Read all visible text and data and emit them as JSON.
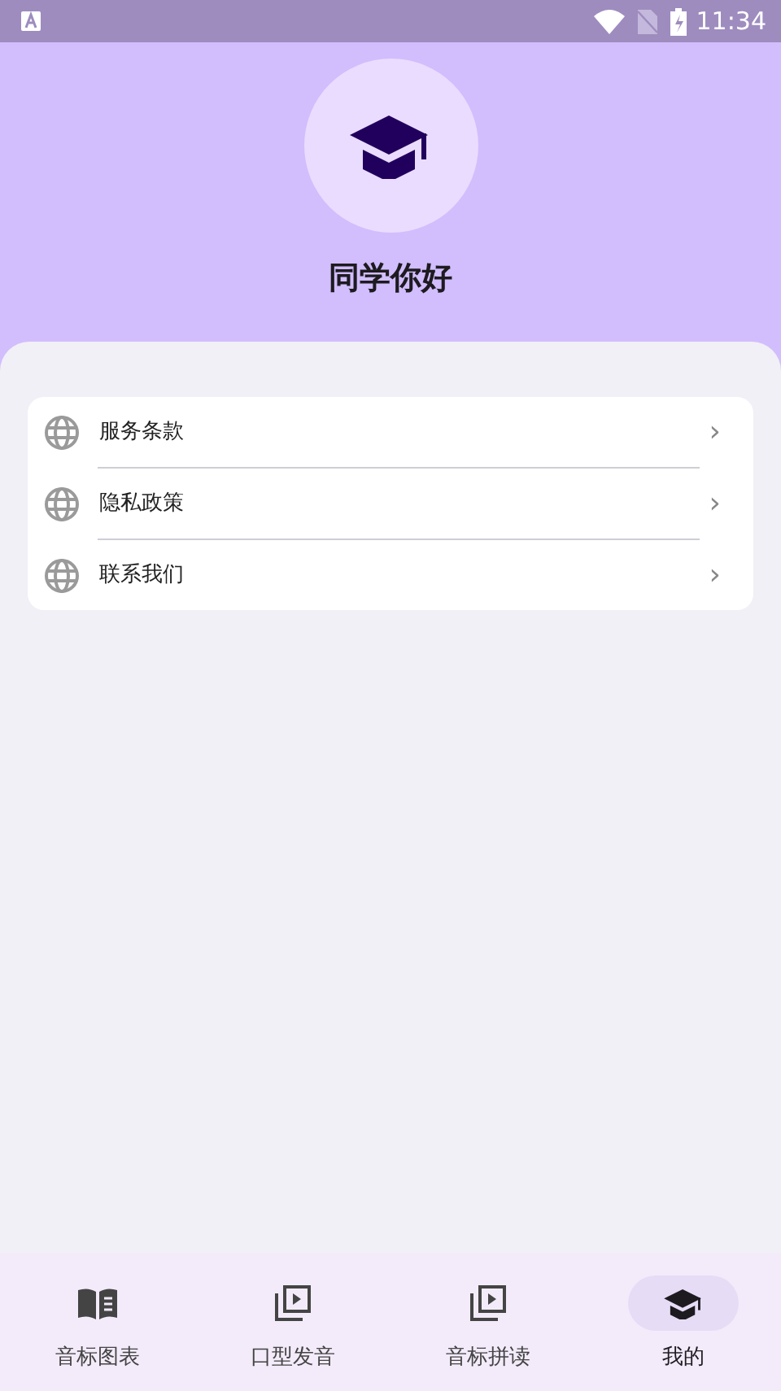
{
  "status_bar": {
    "time": "11:34"
  },
  "profile": {
    "greeting": "同学你好"
  },
  "menu": [
    {
      "label": "服务条款",
      "chevron": "›"
    },
    {
      "label": "隐私政策",
      "chevron": "›"
    },
    {
      "label": "联系我们",
      "chevron": "›"
    }
  ],
  "bottom_nav": [
    {
      "label": "音标图表",
      "kind": "book",
      "selected": false
    },
    {
      "label": "口型发音",
      "kind": "play",
      "selected": false
    },
    {
      "label": "音标拼读",
      "kind": "play",
      "selected": false
    },
    {
      "label": "我的",
      "kind": "cap",
      "selected": true
    }
  ]
}
